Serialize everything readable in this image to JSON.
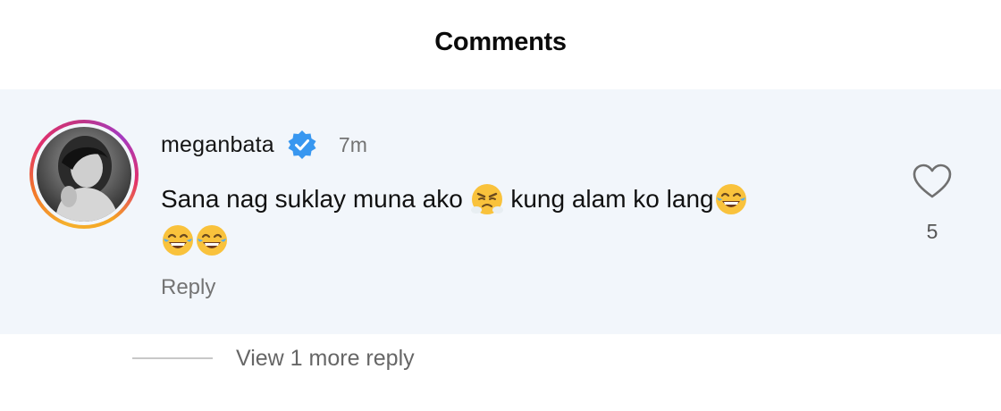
{
  "header": {
    "title": "Comments"
  },
  "comment": {
    "username": "meganbata",
    "verified": true,
    "time": "7m",
    "text_part1": "Sana nag suklay muna ako",
    "text_part2": "kung alam ko lang",
    "emojis": [
      "face-with-steam-icon",
      "face-with-tears-of-joy-icon",
      "face-with-tears-of-joy-icon",
      "face-with-tears-of-joy-icon"
    ],
    "reply_label": "Reply",
    "like_count": "5",
    "view_more_label": "View 1 more reply"
  },
  "colors": {
    "highlight_bg": "#f2f6fb",
    "verified_blue": "#3897f0",
    "muted_text": "#737373"
  }
}
